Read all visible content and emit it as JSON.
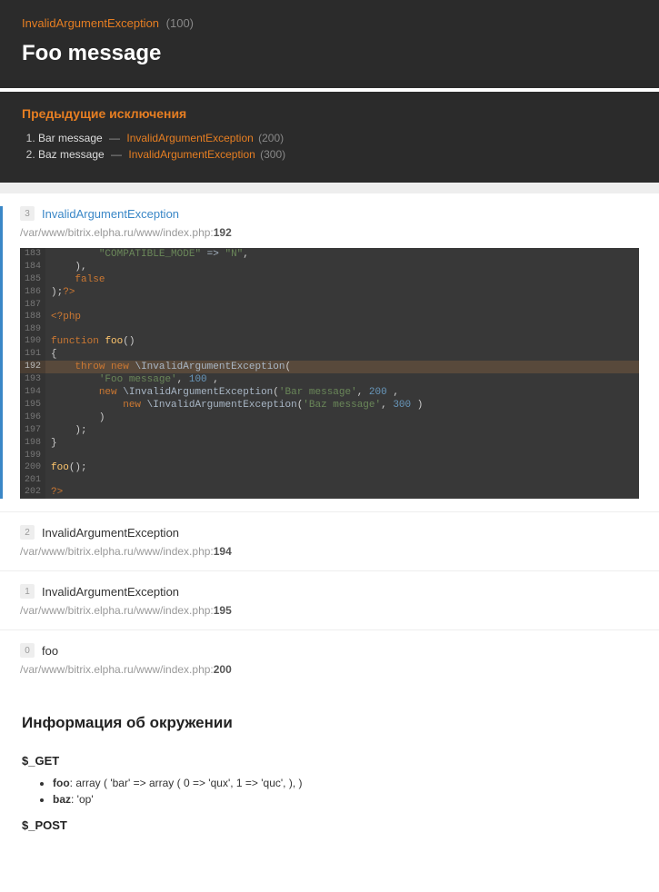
{
  "header": {
    "exception_name": "InvalidArgumentException",
    "exception_code": "(100)",
    "message": "Foo message"
  },
  "previous": {
    "title": "Предыдущие исключения",
    "items": [
      {
        "msg": "Bar message",
        "dash": "—",
        "cls": "InvalidArgumentException",
        "code": "(200)"
      },
      {
        "msg": "Baz message",
        "dash": "—",
        "cls": "InvalidArgumentException",
        "code": "(300)"
      }
    ]
  },
  "frames": [
    {
      "badge": "3",
      "title": "InvalidArgumentException",
      "link": true,
      "path": "/var/www/bitrix.elpha.ru/www/index.php:",
      "line": "192",
      "expanded": true
    },
    {
      "badge": "2",
      "title": "InvalidArgumentException",
      "link": false,
      "path": "/var/www/bitrix.elpha.ru/www/index.php:",
      "line": "194",
      "expanded": false
    },
    {
      "badge": "1",
      "title": "InvalidArgumentException",
      "link": false,
      "path": "/var/www/bitrix.elpha.ru/www/index.php:",
      "line": "195",
      "expanded": false
    },
    {
      "badge": "0",
      "title": "foo",
      "link": false,
      "path": "/var/www/bitrix.elpha.ru/www/index.php:",
      "line": "200",
      "expanded": false
    }
  ],
  "code": {
    "start": 183,
    "highlight": 192,
    "lines": [
      {
        "n": 183,
        "html": "        <span class='tok-str'>\"COMPATIBLE_MODE\"</span> <span class='tok-op'>=&gt;</span> <span class='tok-str'>\"N\"</span>,"
      },
      {
        "n": 184,
        "html": "    ),"
      },
      {
        "n": 185,
        "html": "    <span class='tok-kw'>false</span>"
      },
      {
        "n": 186,
        "html": ");<span class='tok-tag'>?&gt;</span>"
      },
      {
        "n": 187,
        "html": ""
      },
      {
        "n": 188,
        "html": "<span class='tok-tag'>&lt;?php</span>"
      },
      {
        "n": 189,
        "html": ""
      },
      {
        "n": 190,
        "html": "<span class='tok-kw'>function</span> <span class='tok-fn'>foo</span>()"
      },
      {
        "n": 191,
        "html": "{"
      },
      {
        "n": 192,
        "html": "    <span class='tok-kw'>throw</span> <span class='tok-kw'>new</span> <span class='tok-cls'>\\InvalidArgumentException</span>("
      },
      {
        "n": 193,
        "html": "        <span class='tok-str'>'Foo message'</span>, <span class='tok-num'>100</span> ,"
      },
      {
        "n": 194,
        "html": "        <span class='tok-kw'>new</span> <span class='tok-cls'>\\InvalidArgumentException</span>(<span class='tok-str'>'Bar message'</span>, <span class='tok-num'>200</span> ,"
      },
      {
        "n": 195,
        "html": "            <span class='tok-kw'>new</span> <span class='tok-cls'>\\InvalidArgumentException</span>(<span class='tok-str'>'Baz message'</span>, <span class='tok-num'>300</span> )"
      },
      {
        "n": 196,
        "html": "        )"
      },
      {
        "n": 197,
        "html": "    );"
      },
      {
        "n": 198,
        "html": "}"
      },
      {
        "n": 199,
        "html": ""
      },
      {
        "n": 200,
        "html": "<span class='tok-fn'>foo</span>();"
      },
      {
        "n": 201,
        "html": ""
      },
      {
        "n": 202,
        "html": "<span class='tok-tag'>?&gt;</span>"
      }
    ]
  },
  "env": {
    "title": "Информация об окружении",
    "sections": [
      {
        "name": "$_GET",
        "items": [
          {
            "k": "foo",
            "v": ": array ( 'bar' => array ( 0 => 'qux', 1 => 'quc', ), )"
          },
          {
            "k": "baz",
            "v": ": 'op'"
          }
        ]
      },
      {
        "name": "$_POST",
        "items": []
      }
    ]
  }
}
